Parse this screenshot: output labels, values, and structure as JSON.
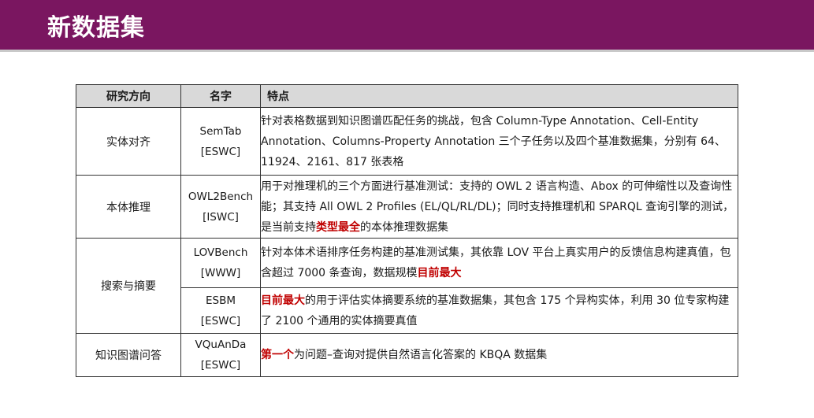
{
  "slide": {
    "title": "新数据集"
  },
  "table": {
    "headers": {
      "direction": "研究方向",
      "name": "名字",
      "features": "特点"
    },
    "rows": [
      {
        "direction": "实体对齐",
        "name_line1": "SemTab",
        "name_line2": "[ESWC]",
        "feature": "针对表格数据到知识图谱匹配任务的挑战，包含 Column-Type Annotation、Cell-Entity Annotation、Columns-Property Annotation 三个子任务以及四个基准数据集，分别有 64、11924、2161、817 张表格"
      },
      {
        "direction": "本体推理",
        "name_line1": "OWL2Bench",
        "name_line2": "[ISWC]",
        "feature_before": "用于对推理机的三个方面进行基准测试：支持的 OWL 2 语言构造、Abox 的可伸缩性以及查询性能；其支持 All OWL 2 Profiles (EL/QL/RL/DL)；同时支持推理机和 SPARQL 查询引擎的测试，是当前支持",
        "feature_highlight": "类型最全",
        "feature_after": "的本体推理数据集"
      },
      {
        "direction": "搜索与摘要",
        "name_line1": "LOVBench",
        "name_line2": "[WWW]",
        "feature_before": "针对本体术语排序任务构建的基准测试集，其依靠 LOV 平台上真实用户的反馈信息构建真值，包含超过 7000 条查询，数据规模",
        "feature_highlight": "目前最大"
      },
      {
        "name_line1": "ESBM",
        "name_line2": "[ESWC]",
        "feature_highlight": "目前最大",
        "feature_after": "的用于评估实体摘要系统的基准数据集，其包含 175 个异构实体，利用 30 位专家构建了 2100 个通用的实体摘要真值"
      },
      {
        "direction": "知识图谱问答",
        "name_line1": "VQuAnDa",
        "name_line2": "[ESWC]",
        "feature_highlight": "第一个",
        "feature_after": "为问题–查询对提供自然语言化答案的 KBQA 数据集"
      }
    ]
  },
  "colors": {
    "title_bar": "#7a1660",
    "header_bg": "#d9d9d9",
    "highlight": "#c00000"
  }
}
